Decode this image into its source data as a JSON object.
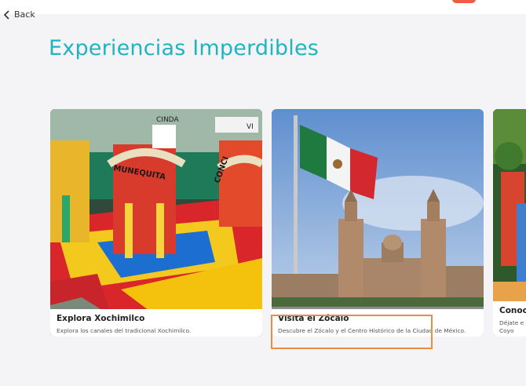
{
  "nav": {
    "back_label": "Back"
  },
  "page": {
    "title": "Experiencias Imperdibles"
  },
  "cards": [
    {
      "title": "Explora Xochimilco",
      "description": "Explora los canales del tradicional Xochimilco.",
      "sign1": "CINDA",
      "sign2": "MUNEQUITA",
      "sign3": "CONCI",
      "sign4": "VI"
    },
    {
      "title": "Visita el Zócalo",
      "description": "Descubre el Zócalo y el Centro Histórico de la Ciudad de México."
    },
    {
      "title": "Conoc",
      "description": "Déjate e de Coyo"
    }
  ],
  "colors": {
    "accent": "#20b3c2",
    "highlight": "#ee8b43",
    "status": "#ef5b45"
  }
}
